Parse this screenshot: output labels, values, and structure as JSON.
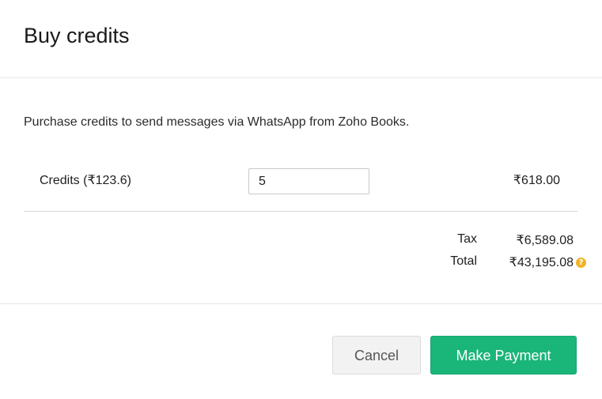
{
  "dialog": {
    "title": "Buy credits",
    "description": "Purchase credits to send messages via WhatsApp from Zoho Books."
  },
  "credits": {
    "label": "Credits (₹123.6)",
    "quantity": "5",
    "amount": "₹618.00"
  },
  "summary": {
    "tax_label": "Tax",
    "tax_value": "₹6,589.08",
    "total_label": "Total",
    "total_value": "₹43,195.08",
    "help_icon": "?"
  },
  "footer": {
    "cancel_label": "Cancel",
    "pay_label": "Make Payment"
  },
  "colors": {
    "primary": "#1ab579",
    "help_icon": "#f0b429"
  }
}
